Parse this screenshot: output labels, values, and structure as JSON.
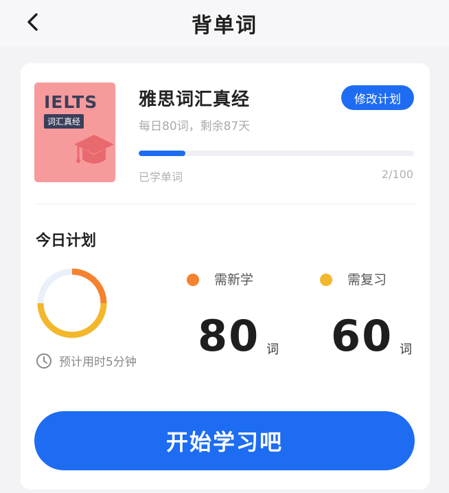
{
  "header": {
    "title": "背单词",
    "back_icon": "chevron-left-icon"
  },
  "book": {
    "cover_title": "IELTS",
    "cover_subtitle": "词汇真经",
    "name": "雅思词汇真经",
    "plan_text": "每日80词，剩余87天",
    "edit_button": "修改计划",
    "learned_label": "已学单词",
    "learned_count": "2/100",
    "progress": 0.17
  },
  "plan": {
    "title": "今日计划",
    "estimate_text": "预计用时5分钟",
    "new": {
      "label": "需新学",
      "count": "80",
      "unit": "词"
    },
    "review": {
      "label": "需复习",
      "count": "60",
      "unit": "词"
    }
  },
  "start_button": "开始学习吧",
  "colors": {
    "accent": "#1e6cf1",
    "new_dot": "#f5822f",
    "review_dot": "#f2b72a",
    "ring_track": "#e9f0fa"
  }
}
